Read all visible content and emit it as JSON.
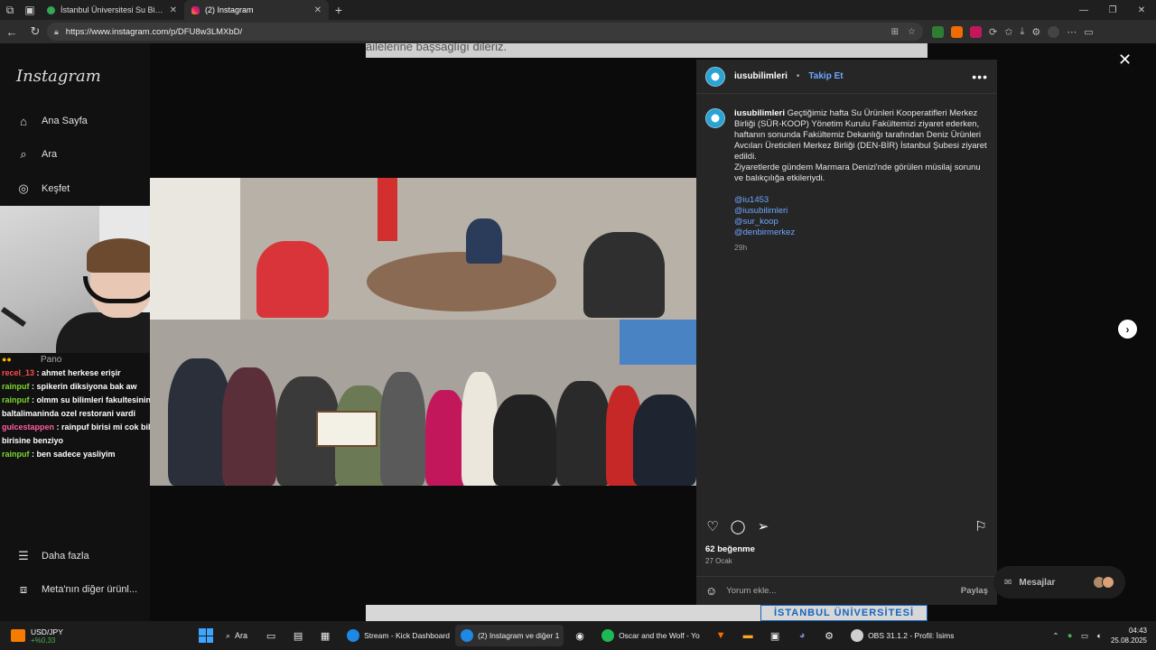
{
  "browser": {
    "tabs": [
      {
        "label": "İstanbul Üniversitesi Su Bilimleri Fakültesi",
        "active": false
      },
      {
        "label": "(2) Instagram",
        "active": true
      }
    ],
    "url": "https://www.instagram.com/p/DFU8w3LMXbD/"
  },
  "background": {
    "top_text": "ailelerine başsağlığı dileriz.",
    "bottom_text": "İSTANBUL ÜNİVERSİTESİ"
  },
  "sidebar": {
    "logo": "Instagram",
    "items": [
      {
        "label": "Ana Sayfa",
        "icon": "home-icon"
      },
      {
        "label": "Ara",
        "icon": "search-icon"
      },
      {
        "label": "Keşfet",
        "icon": "compass-icon"
      }
    ],
    "more_label": "Daha fazla",
    "meta_label": "Meta'nın diğer ürünl..."
  },
  "chat": {
    "pano": "Pano",
    "messages": [
      {
        "user": "recel_13",
        "text": "ahmet herkese erişir"
      },
      {
        "user": "rainpuf",
        "text": "spikerin diksiyona bak aw"
      },
      {
        "user": "rainpuf",
        "text": "olmm su bilimleri fakultesinin mi baltalimaninda ozel restorani vardi"
      },
      {
        "user": "gulcestappen",
        "text": "rainpuf birisi mi cok bilgili birisine benziyo"
      },
      {
        "user": "rainpuf",
        "text": "ben sadece yasliyim"
      }
    ]
  },
  "post": {
    "username": "iusubilimleri",
    "follow_label": "Takip Et",
    "caption_user": "iusubilimleri",
    "caption_p1": "Geçtiğimiz hafta Su Ürünleri Kooperatifleri Merkez Birliği (SÜR-KOOP) Yönetim Kurulu Fakültemizi ziyaret ederken, haftanın sonunda Fakültemiz Dekanlığı tarafından Deniz Ürünleri Avcıları Üreticileri Merkez Birliği (DEN-BİR) İstanbul Şubesi ziyaret edildi.",
    "caption_p2": "Ziyaretlerde gündem Marmara Denizi'nde görülen müsilaj sorunu ve balıkçılığa etkileriydi.",
    "tags": [
      "@iu1453",
      "@iusubilimleri",
      "@sur_koop",
      "@denbirmerkez"
    ],
    "time": "29h",
    "likes": "62 beğenme",
    "date": "27 Ocak",
    "comment_placeholder": "Yorum ekle...",
    "share_label": "Paylaş",
    "messages_label": "Mesajlar"
  },
  "taskbar": {
    "ticker_symbol": "USD/JPY",
    "ticker_change": "+%0,33",
    "search_label": "Ara",
    "apps": [
      {
        "label": "Stream - Kick Dashboard",
        "color": "#1e88e5"
      },
      {
        "label": "(2) Instagram ve diğer 1",
        "color": "#1e88e5",
        "active": true
      },
      {
        "label": "Oscar and the Wolf - Yo",
        "color": "#1db954"
      },
      {
        "label": "OBS 31.1.2 - Profil: İsims",
        "color": "#cfcfcf"
      }
    ],
    "time": "04:43",
    "date": "25.08.2025"
  },
  "colors": {
    "accent_link": "#6ea8ff",
    "panel_bg": "#262626"
  }
}
